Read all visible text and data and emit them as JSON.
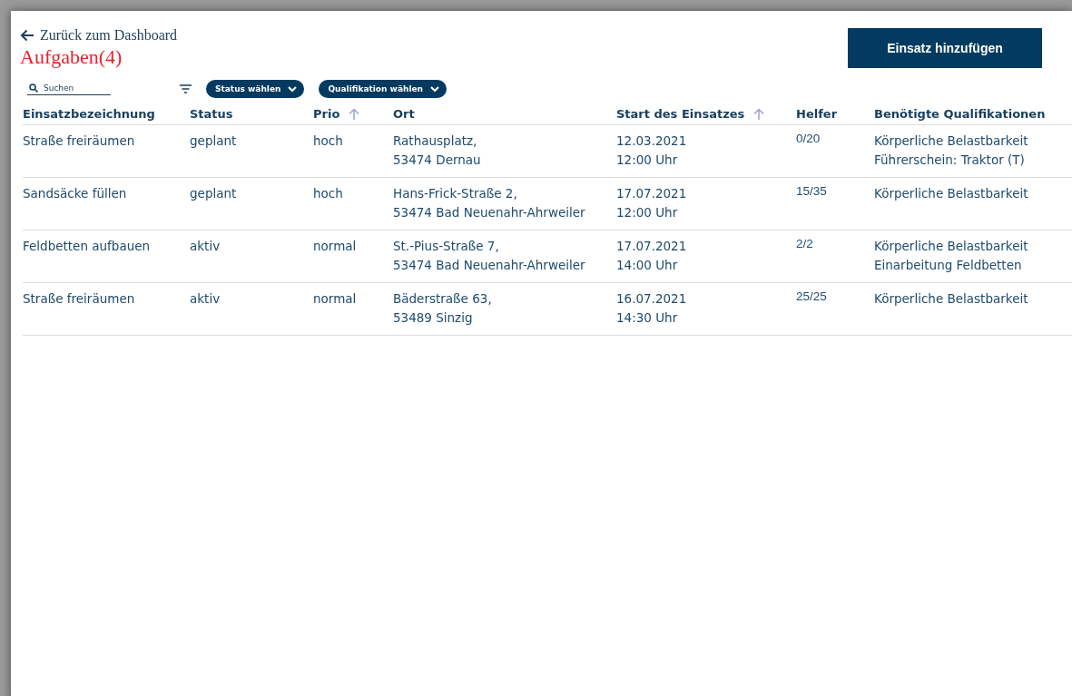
{
  "back_link": {
    "label": "Zurück zum Dashboard"
  },
  "title": "Aufgaben(4)",
  "add_button": {
    "label": "Einsatz hinzufügen"
  },
  "search": {
    "placeholder": "Suchen"
  },
  "filters": [
    {
      "label": "Status wählen"
    },
    {
      "label": "Qualifikation wählen"
    }
  ],
  "table": {
    "columns": [
      {
        "label": "Einsatzbezeichnung",
        "sorted": false
      },
      {
        "label": "Status",
        "sorted": false
      },
      {
        "label": "Prio",
        "sorted": true
      },
      {
        "label": "Ort",
        "sorted": false
      },
      {
        "label": "Start des Einsatzes",
        "sorted": true
      },
      {
        "label": "Helfer",
        "sorted": false
      },
      {
        "label": "Benötigte Qualifikationen",
        "sorted": false
      }
    ],
    "rows": [
      {
        "cells": [
          [
            "Straße freiräumen"
          ],
          [
            "geplant"
          ],
          [
            "hoch"
          ],
          [
            "Rathausplatz,",
            "53474 Dernau"
          ],
          [
            "12.03.2021",
            "12:00 Uhr"
          ],
          [
            "0/20"
          ],
          [
            "Körperliche Belastbarkeit",
            "Führerschein: Traktor (T)"
          ]
        ]
      },
      {
        "cells": [
          [
            "Sandsäcke füllen"
          ],
          [
            "geplant"
          ],
          [
            "hoch"
          ],
          [
            "Hans-Frick-Straße 2,",
            "53474 Bad Neuenahr-Ahrweiler"
          ],
          [
            "17.07.2021",
            "12:00 Uhr"
          ],
          [
            "15/35"
          ],
          [
            "Körperliche Belastbarkeit"
          ]
        ]
      },
      {
        "cells": [
          [
            "Feldbetten aufbauen"
          ],
          [
            "aktiv"
          ],
          [
            "normal"
          ],
          [
            "St.-Pius-Straße 7,",
            "53474 Bad Neuenahr-Ahrweiler"
          ],
          [
            "17.07.2021",
            "14:00 Uhr"
          ],
          [
            "2/2"
          ],
          [
            "Körperliche Belastbarkeit",
            "Einarbeitung Feldbetten"
          ]
        ]
      },
      {
        "cells": [
          [
            "Straße freiräumen"
          ],
          [
            "aktiv"
          ],
          [
            "normal"
          ],
          [
            "Bäderstraße 63,",
            "53489 Sinzig"
          ],
          [
            "16.07.2021",
            "14:30 Uhr"
          ],
          [
            "25/25"
          ],
          [
            "Körperliche Belastbarkeit"
          ]
        ]
      }
    ]
  }
}
